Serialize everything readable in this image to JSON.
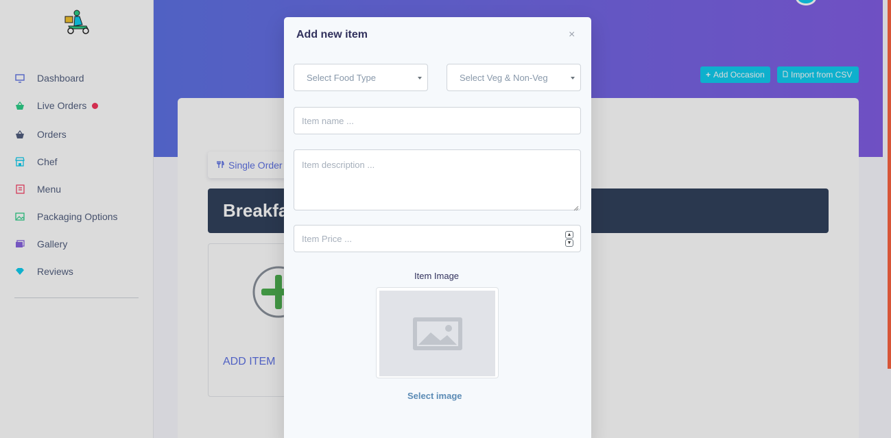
{
  "sidebar": {
    "items": [
      {
        "label": "Dashboard",
        "icon": "monitor-icon",
        "color": "#5e72e4"
      },
      {
        "label": "Live Orders",
        "icon": "basket-icon",
        "color": "#2dce89",
        "badge": true
      },
      {
        "label": "Orders",
        "icon": "basket-icon",
        "color": "#525f7f"
      },
      {
        "label": "Chef",
        "icon": "shop-icon",
        "color": "#11cdef"
      },
      {
        "label": "Menu",
        "icon": "receipt-icon",
        "color": "#f5365c"
      },
      {
        "label": "Packaging Options",
        "icon": "image-icon",
        "color": "#2dce89"
      },
      {
        "label": "Gallery",
        "icon": "images-icon",
        "color": "#8965e0"
      },
      {
        "label": "Reviews",
        "icon": "diamond-icon",
        "color": "#11cdef"
      }
    ]
  },
  "header": {
    "add_occasion": "Add Occasion",
    "import_csv": "Import from CSV"
  },
  "content": {
    "tab_label": "Single Order",
    "banner_text": "Breakfa",
    "add_item_label": "ADD ITEM"
  },
  "modal": {
    "title": "Add new item",
    "close": "×",
    "food_type_placeholder": "Select Food Type",
    "veg_placeholder": "Select Veg & Non-Veg",
    "item_name_placeholder": "Item name ...",
    "item_description_placeholder": "Item description ...",
    "item_price_placeholder": "Item Price ...",
    "image_label": "Item Image",
    "select_image": "Select image"
  },
  "colors": {
    "primary": "#5e72e4",
    "info": "#11cdef",
    "banner": "#32425c"
  }
}
